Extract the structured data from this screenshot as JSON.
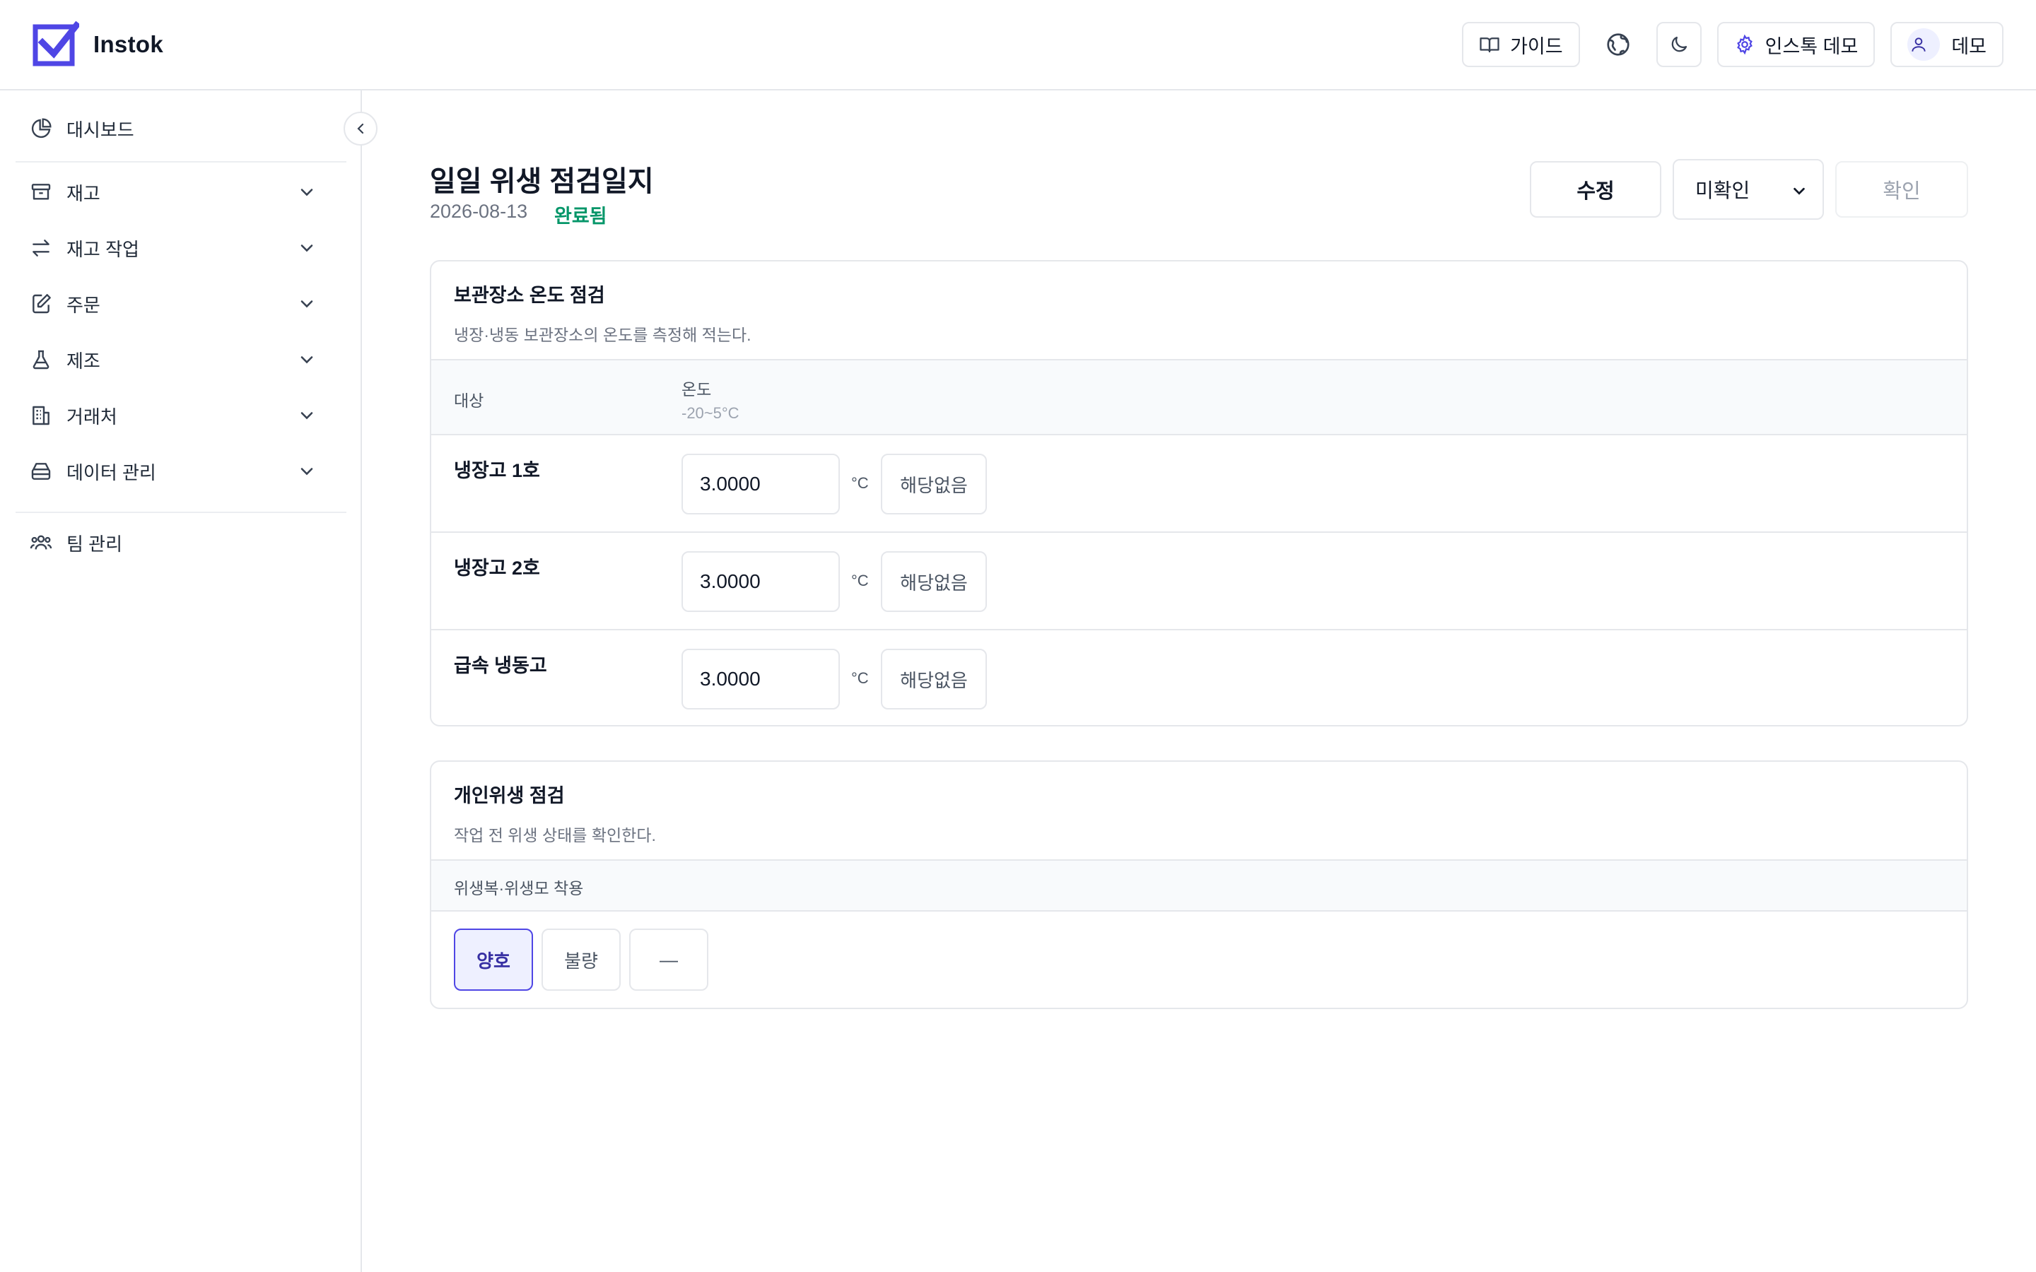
{
  "app": {
    "name": "Instok"
  },
  "header": {
    "guide_label": "가이드",
    "workspace_label": "인스톡 데모",
    "user_label": "데모"
  },
  "sidebar": {
    "items": [
      {
        "label": "대시보드",
        "icon": "pie-chart-icon"
      },
      {
        "label": "재고",
        "icon": "archive-box-icon"
      },
      {
        "label": "재고 작업",
        "icon": "arrows-exchange-icon"
      },
      {
        "label": "주문",
        "icon": "edit-document-icon"
      },
      {
        "label": "제조",
        "icon": "flask-icon"
      },
      {
        "label": "거래처",
        "icon": "building-icon"
      },
      {
        "label": "데이터 관리",
        "icon": "database-stack-icon"
      },
      {
        "label": "팀 관리",
        "icon": "users-icon"
      }
    ]
  },
  "page": {
    "title": "일일 위생 점검일지",
    "date": "2026-08-13",
    "status": "완료됨",
    "edit_label": "수정",
    "select_value": "미확인",
    "confirm_label": "확인"
  },
  "temperature_section": {
    "title": "보관장소 온도 점검",
    "description": "냉장·냉동 보관장소의 온도를 측정해 적는다.",
    "col_target": "대상",
    "col_temp": "온도",
    "col_temp_range": "-20~5°C",
    "rows": [
      {
        "name": "냉장고 1호",
        "value": "3.0000",
        "unit": "°C",
        "na_label": "해당없음"
      },
      {
        "name": "냉장고 2호",
        "value": "3.0000",
        "unit": "°C",
        "na_label": "해당없음"
      },
      {
        "name": "급속 냉동고",
        "value": "3.0000",
        "unit": "°C",
        "na_label": "해당없음"
      }
    ]
  },
  "hygiene_section": {
    "title": "개인위생 점검",
    "description": "작업 전 위생 상태를 확인한다.",
    "item_label": "위생복·위생모 착용",
    "options": [
      "양호",
      "불량",
      "—"
    ],
    "selected": "양호"
  },
  "colors": {
    "accent": "#4f46e5",
    "status_done": "#059669",
    "border": "#e5e7eb"
  }
}
